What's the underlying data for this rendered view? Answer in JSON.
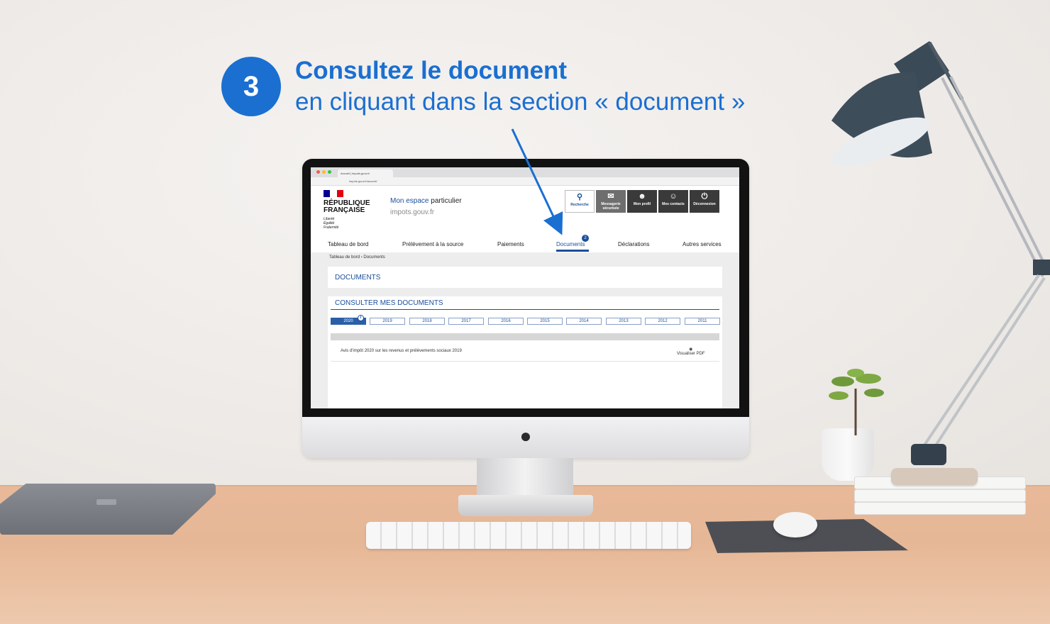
{
  "heading": {
    "step_number": "3",
    "title": "Consultez le document",
    "subtitle": "en cliquant dans la section « document »"
  },
  "browser": {
    "tab_title": "Accueil | impots.gouv.fr",
    "url": "impots.gouv.fr/accueil/"
  },
  "site": {
    "republique": "RÉPUBLIQUE",
    "francaise": "FRANÇAISE",
    "motto": [
      "Liberté",
      "Égalité",
      "Fraternité"
    ],
    "espace_prefix": "Mon espace",
    "espace_suffix": " particulier",
    "domain": "impots.gouv.fr",
    "header_buttons": [
      {
        "label": "Recherche",
        "icon": "search-icon"
      },
      {
        "label": "Messagerie sécurisée",
        "icon": "mail-icon"
      },
      {
        "label": "Mon profil",
        "icon": "user-icon"
      },
      {
        "label": "Mes contacts",
        "icon": "contacts-icon"
      },
      {
        "label": "Déconnexion",
        "icon": "power-icon"
      }
    ],
    "nav": [
      "Tableau de bord",
      "Prélèvement à la source",
      "Paiements",
      "Documents",
      "Déclarations",
      "Autres services"
    ],
    "nav_active": "Documents",
    "documents_badge": "2",
    "breadcrumb": [
      "Tableau de bord",
      "Documents"
    ],
    "breadcrumb_sep": "›",
    "documents_title": "DOCUMENTS",
    "consulter_title": "CONSULTER MES DOCUMENTS",
    "years": [
      "2020",
      "2019",
      "2018",
      "2017",
      "2016",
      "2015",
      "2014",
      "2013",
      "2012",
      "2011"
    ],
    "selected_year": "2020",
    "info_mark": "i",
    "document_row": {
      "name": "Avis d'impôt 2020 sur les revenus et prélèvements sociaux 2019",
      "view_label": "Visualiser",
      "format": "PDF",
      "view_icon": "eye-icon"
    }
  },
  "colors": {
    "accent_blue": "#1a6fd1",
    "site_blue": "#1a4f9c",
    "flag_blue": "#000091",
    "flag_red": "#e1000f"
  }
}
